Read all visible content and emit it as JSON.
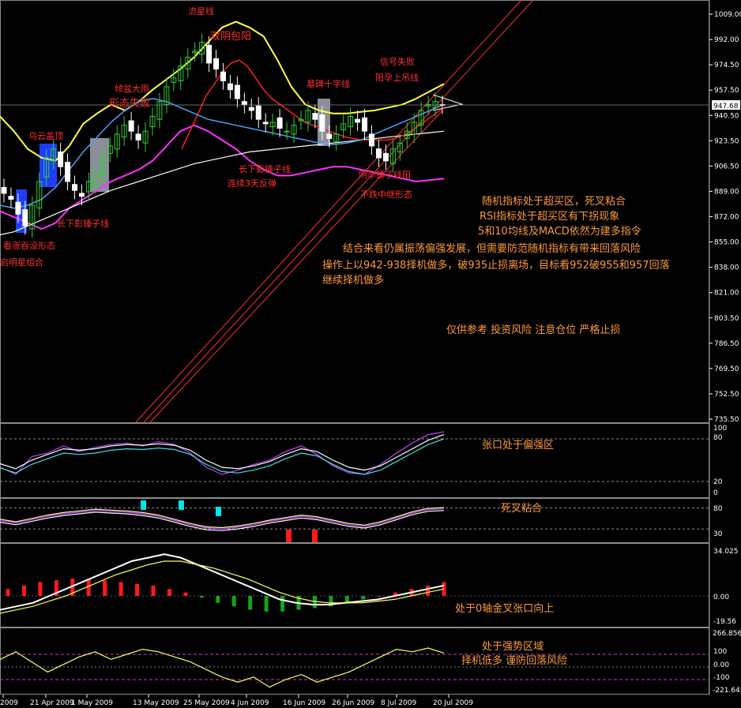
{
  "colors": {
    "background": "#000000",
    "axis_text": "#ffffff",
    "pattern_label": "#ff3030",
    "comment": "#ff9a3c",
    "bollinger": "#ffff40",
    "lower_band": "#ff30ff",
    "ma_red": "#ff2020",
    "ma_blue": "#4aa0ff",
    "ma_white": "#ffffff",
    "candle_up": "#30d030",
    "candle_down": "#ffffff",
    "channel": "#ff3030",
    "panel_border": "#8a8a8a",
    "highlight_blue": "#1e3cff",
    "highlight_gray": "#8a8f99",
    "hist_pos": "#ff1a1a",
    "hist_neg": "#17a217",
    "marker_cyan": "#00e5e5",
    "marker_red": "#ff1a1a",
    "level_line": "#c040c0"
  },
  "price_axis_labels": [
    "1009.00",
    "992.00",
    "974.50",
    "957.50",
    "940.50",
    "923.50",
    "906.50",
    "889.00",
    "872.00",
    "855.00",
    "838.00",
    "821.00",
    "803.50",
    "786.50",
    "769.50",
    "752.50",
    "735.50"
  ],
  "current_price": "947.68",
  "date_labels": [
    "2009",
    "21 Apr 2009",
    "1 May 2009",
    "13 May 2009",
    "25 May 2009",
    "4 Jun 2009",
    "16 Jun 2009",
    "26 Jun 2009",
    "8 Jul 2009",
    "20 Jul 2009"
  ],
  "pattern_labels": [
    "流星线",
    "双阴包阳",
    "形态失败",
    "倾盆大雨",
    "乌云盖顶",
    "看涨吞没形态",
    "启明星组合",
    "长下影锤子线",
    "长下影锤子线",
    "连续3天反弹",
    "墓碑十字线",
    "信号失败",
    "阳孕上吊线",
    "阴孕锤子线阳",
    "不跌中继形态"
  ],
  "commentary": {
    "line1": "随机指标处于超买区，死叉粘合",
    "line2": "RSI指标处于超买区有下拐现象",
    "line3": "5和10均线及MACD依然为建多指令",
    "line4": "结合来看仍属振荡偏强发展，但需要防范随机指标有带来回落风险",
    "line5": "操作上以942-938择机做多，破935止损离场，目标看952破955和957回落",
    "line6": "继续择机做多",
    "disclaimer": "仅供参考 投资风险 注意仓位 严格止损"
  },
  "panel_notes": {
    "kd": "张口处于偏强区",
    "rsi": "死叉粘合",
    "macd": "处于0轴金叉张口向上",
    "cci1": "处于强势区域",
    "cci2": "择机低多 谨防回落风险"
  },
  "panel_axis_labels": {
    "kd": [
      "100",
      "80",
      "20",
      "0"
    ],
    "rsi": [
      "80",
      "30"
    ],
    "macd": [
      "34.025",
      "0.00",
      "-19.56"
    ],
    "cci": [
      "266.8569",
      "100",
      "0.00",
      "-100",
      "-221.645"
    ]
  },
  "chart_data": {
    "type": "candlestick",
    "y_range": [
      735.5,
      1009.0
    ],
    "x_labels": [
      "2009",
      "21 Apr 2009",
      "1 May 2009",
      "13 May 2009",
      "25 May 2009",
      "4 Jun 2009",
      "16 Jun 2009",
      "26 Jun 2009",
      "8 Jul 2009",
      "20 Jul 2009"
    ],
    "closes": [
      888,
      884,
      874,
      866,
      880,
      896,
      912,
      918,
      906,
      896,
      890,
      886,
      896,
      902,
      912,
      920,
      928,
      934,
      930,
      924,
      930,
      940,
      950,
      960,
      966,
      974,
      980,
      984,
      990,
      976,
      972,
      964,
      958,
      952,
      948,
      944,
      938,
      935,
      936,
      932,
      930,
      934,
      938,
      944,
      938,
      930,
      925,
      928,
      935,
      940,
      936,
      930,
      920,
      912,
      910,
      918,
      922,
      930,
      936,
      944,
      948,
      950,
      947.68
    ],
    "upper_band": [
      940,
      930,
      918,
      912,
      910,
      920,
      935,
      942,
      948,
      944,
      950,
      958,
      965,
      972,
      980,
      990,
      1000,
      1004,
      1000,
      994,
      978,
      960,
      948,
      944,
      942,
      942,
      943,
      944,
      946,
      948,
      952,
      957,
      962
    ],
    "lower_band": [
      876,
      872,
      868,
      864,
      868,
      878,
      884,
      890,
      896,
      900,
      904,
      910,
      920,
      930,
      934,
      930,
      924,
      918,
      910,
      904,
      900,
      900,
      902,
      904,
      906,
      906,
      904,
      902,
      900,
      898,
      896,
      897,
      898
    ],
    "ma_white": [
      860,
      862,
      866,
      870,
      874,
      878,
      882,
      886,
      890,
      893,
      896,
      899,
      902,
      905,
      908,
      910,
      912,
      914,
      916,
      917,
      918,
      919,
      920,
      921,
      922,
      923,
      924,
      925,
      926,
      927,
      928,
      929,
      930
    ],
    "ma_red": [
      918,
      930,
      942,
      954,
      962,
      970,
      976,
      978,
      974,
      966,
      958,
      952,
      948,
      944,
      940,
      936,
      934,
      932,
      930,
      928,
      926,
      925,
      924,
      924,
      924,
      924,
      925,
      927,
      930,
      934,
      938,
      942,
      946
    ],
    "ma_blue": [
      880,
      878,
      880,
      884,
      892,
      904,
      916,
      926,
      936,
      944,
      950,
      952,
      950,
      946,
      942,
      938,
      936,
      934,
      932,
      930,
      928,
      926,
      924,
      922,
      921,
      922,
      924,
      928,
      932,
      936,
      940,
      944,
      948
    ],
    "kd_k": [
      40,
      30,
      55,
      60,
      70,
      62,
      68,
      72,
      74,
      70,
      76,
      72,
      60,
      40,
      30,
      36,
      44,
      50,
      62,
      70,
      58,
      42,
      32,
      30,
      44,
      60,
      74,
      86,
      90
    ],
    "kd_d": [
      45,
      38,
      50,
      58,
      66,
      64,
      66,
      70,
      72,
      71,
      73,
      71,
      64,
      50,
      40,
      38,
      42,
      48,
      58,
      66,
      62,
      50,
      40,
      36,
      42,
      54,
      66,
      78,
      86
    ],
    "rsi": [
      50,
      44,
      52,
      60,
      66,
      70,
      74,
      72,
      70,
      66,
      60,
      50,
      40,
      32,
      30,
      34,
      40,
      48,
      54,
      60,
      56,
      48,
      40,
      36,
      44,
      56,
      68,
      76,
      78
    ],
    "macd_hist": [
      4,
      6,
      8,
      9,
      10,
      10,
      9,
      8,
      7,
      6,
      4,
      2,
      -1,
      -4,
      -6,
      -8,
      -9,
      -9,
      -8,
      -7,
      -6,
      -4,
      -2,
      0,
      2,
      4,
      6,
      8
    ],
    "macd_line": [
      -8,
      -6,
      -4,
      0,
      4,
      8,
      12,
      16,
      20,
      22,
      24,
      22,
      18,
      14,
      10,
      6,
      2,
      -2,
      -4,
      -5,
      -5,
      -4,
      -3,
      -2,
      0,
      2,
      4,
      6
    ],
    "macd_signal": [
      -10,
      -8,
      -6,
      -3,
      0,
      4,
      8,
      12,
      15,
      18,
      20,
      20,
      18,
      16,
      13,
      10,
      6,
      2,
      -1,
      -3,
      -4,
      -4,
      -4,
      -3,
      -2,
      0,
      2,
      4
    ],
    "cci": [
      60,
      120,
      40,
      -40,
      20,
      80,
      120,
      60,
      100,
      140,
      120,
      80,
      40,
      -20,
      -80,
      -120,
      -80,
      -160,
      -100,
      -60,
      -120,
      -80,
      -40,
      20,
      80,
      140,
      120,
      150,
      110
    ]
  }
}
